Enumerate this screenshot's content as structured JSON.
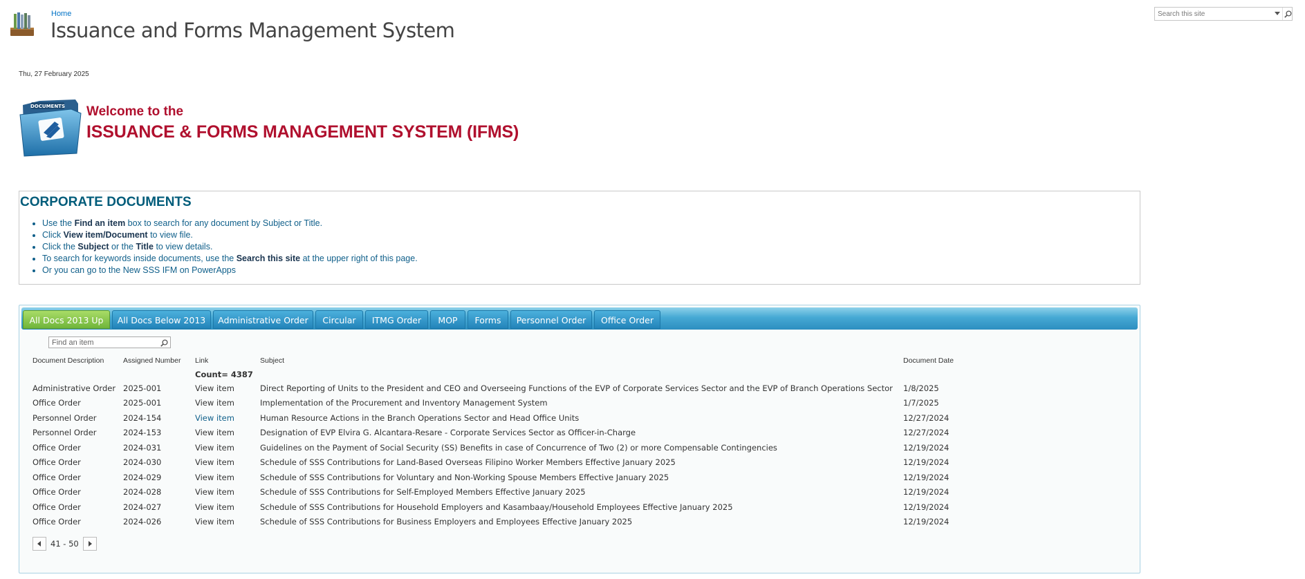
{
  "header": {
    "breadcrumb": "Home",
    "site_title": "Issuance and Forms Management System",
    "search_placeholder": "Search this site",
    "date": "Thu, 27 February 2025"
  },
  "logo": {
    "folder_label": "DOCUMENTS"
  },
  "welcome": {
    "line1": "Welcome to the",
    "line2": "ISSUANCE & FORMS MANAGEMENT SYSTEM (IFMS)"
  },
  "corporate": {
    "title": "CORPORATE DOCUMENTS",
    "items": [
      {
        "pre": "Use the ",
        "bold": "Find an item",
        "post": " box to search for any document by Subject or Title."
      },
      {
        "pre": "Click ",
        "bold": "View item/Document",
        "post": " to view file."
      },
      {
        "pre": "Click the ",
        "bold": "Subject",
        "mid": " or the ",
        "bold2": "Title",
        "post": " to view details."
      },
      {
        "pre": "To search for keywords inside documents, use the ",
        "bold": "Search this site",
        "post": " at the upper right of this page."
      },
      {
        "pre": "Or you can go to the ",
        "link": "New SSS IFM on PowerApps",
        "post": ""
      }
    ]
  },
  "tabs": [
    {
      "label": "All Docs 2013 Up",
      "active": true
    },
    {
      "label": "All Docs Below 2013"
    },
    {
      "label": "Administrative Order"
    },
    {
      "label": "Circular"
    },
    {
      "label": "ITMG Order"
    },
    {
      "label": "MOP"
    },
    {
      "label": "Forms"
    },
    {
      "label": "Personnel Order"
    },
    {
      "label": "Office Order"
    }
  ],
  "find_placeholder": "Find an item",
  "table": {
    "headers": [
      "Document Description",
      "Assigned Number",
      "Link",
      "Subject",
      "Document Date"
    ],
    "count_label": "Count= 4387",
    "rows": [
      {
        "desc": "Administrative Order",
        "num": "2025-001",
        "link": "View item",
        "subject": "Direct Reporting of Units to the President and CEO and Overseeing Functions of the EVP of Corporate Services Sector and the EVP of Branch Operations Sector",
        "date": "1/8/2025"
      },
      {
        "desc": "Office Order",
        "num": "2025-001",
        "link": "View item",
        "subject": "Implementation of the Procurement and Inventory Management System",
        "date": "1/7/2025"
      },
      {
        "desc": "Personnel Order",
        "num": "2024-154",
        "link": "View item",
        "subject": "Human Resource Actions in the Branch Operations Sector and Head Office Units",
        "date": "12/27/2024",
        "visited": true
      },
      {
        "desc": "Personnel Order",
        "num": "2024-153",
        "link": "View item",
        "subject": "Designation of EVP Elvira G. Alcantara-Resare - Corporate Services Sector as Officer-in-Charge",
        "date": "12/27/2024"
      },
      {
        "desc": "Office Order",
        "num": "2024-031",
        "link": "View item",
        "subject": "Guidelines on the Payment of Social Security (SS) Benefits in case of Concurrence of Two (2) or more Compensable Contingencies",
        "date": "12/19/2024"
      },
      {
        "desc": "Office Order",
        "num": "2024-030",
        "link": "View item",
        "subject": "Schedule of SSS Contributions for Land-Based Overseas Filipino Worker Members Effective January 2025",
        "date": "12/19/2024"
      },
      {
        "desc": "Office Order",
        "num": "2024-029",
        "link": "View item",
        "subject": "Schedule of SSS Contributions for Voluntary and Non-Working Spouse Members Effective January 2025",
        "date": "12/19/2024"
      },
      {
        "desc": "Office Order",
        "num": "2024-028",
        "link": "View item",
        "subject": "Schedule of SSS Contributions for Self-Employed Members Effective January 2025",
        "date": "12/19/2024"
      },
      {
        "desc": "Office Order",
        "num": "2024-027",
        "link": "View item",
        "subject": "Schedule of SSS Contributions for Household Employers and Kasambaay/Household Employees Effective January 2025",
        "date": "12/19/2024"
      },
      {
        "desc": "Office Order",
        "num": "2024-026",
        "link": "View item",
        "subject": "Schedule of SSS Contributions for Business Employers and Employees Effective January 2025",
        "date": "12/19/2024"
      }
    ]
  },
  "pager": {
    "range": "41 - 50"
  },
  "colors": {
    "title_red": "#b0102e",
    "heading_teal": "#005c7a",
    "link_blue": "#0f5f8a",
    "tab_blue": "#2d8ec0",
    "tab_active_green": "#6fb53a"
  }
}
